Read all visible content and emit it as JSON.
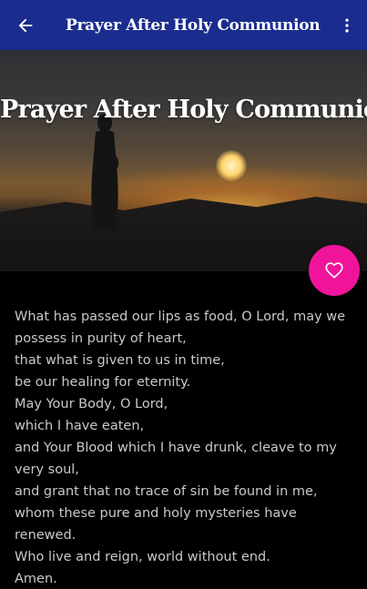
{
  "app_bar": {
    "title": "Prayer After Holy Communion",
    "back_icon": "arrow-back-icon",
    "menu_icon": "more-vert-icon",
    "background_color": "#1b2c8f"
  },
  "header": {
    "title": "Prayer After Holy Communion"
  },
  "fab": {
    "icon": "heart-outline-icon",
    "color": "#f0149a"
  },
  "prayer": {
    "lines": [
      "What has passed our lips as food, O Lord, may we possess in purity of heart,",
      "that what is given to us in time,",
      "be our healing for eternity.",
      "May Your Body, O Lord,",
      "which I have eaten,",
      "and Your Blood which I have drunk, cleave to my very soul,",
      "and grant that no trace of sin be found in me,",
      "whom these pure and holy mysteries have renewed.",
      "Who live and reign, world without end.",
      "Amen."
    ]
  }
}
